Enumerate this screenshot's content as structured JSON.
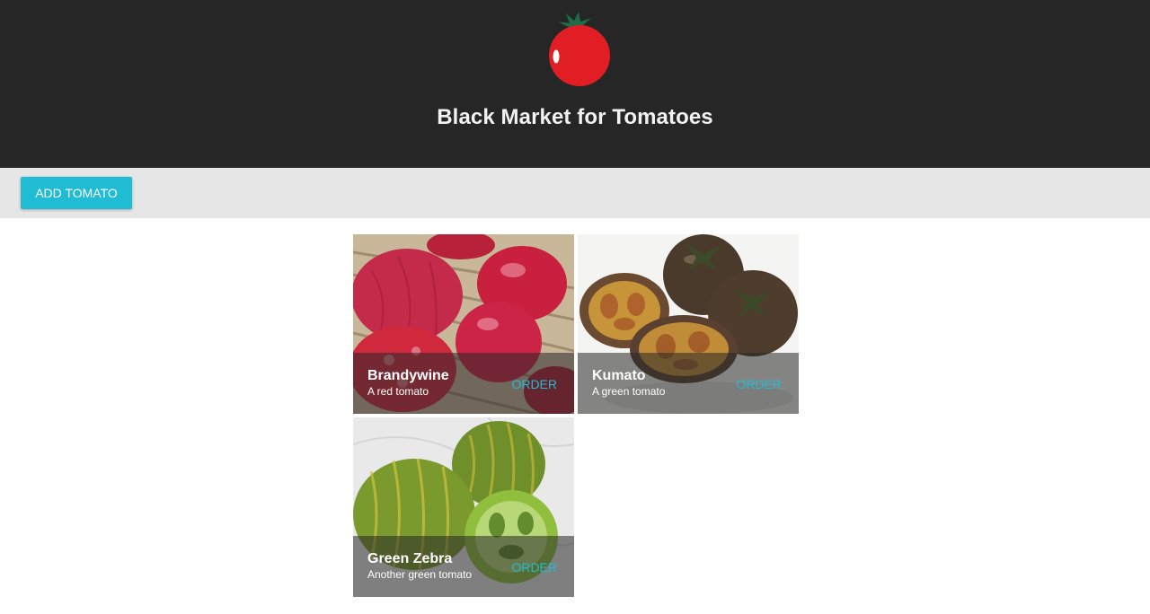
{
  "header": {
    "logo_icon": "tomato-logo-icon",
    "title": "Black Market for Tomatoes"
  },
  "toolbar": {
    "add_label": "ADD TOMATO"
  },
  "tomatoes": [
    {
      "name": "Brandywine",
      "description": "A red tomato",
      "order_label": "ORDER",
      "image_icon": "tomato-photo-red"
    },
    {
      "name": "Kumato",
      "description": "A green tomato",
      "order_label": "ORDER",
      "image_icon": "tomato-photo-dark"
    },
    {
      "name": "Green Zebra",
      "description": "Another green tomato",
      "order_label": "ORDER",
      "image_icon": "tomato-photo-green"
    }
  ],
  "colors": {
    "header_bg": "#262626",
    "toolbar_bg": "#e6e6e6",
    "accent": "#1fbcd3",
    "tomato_red": "#e21e25"
  }
}
